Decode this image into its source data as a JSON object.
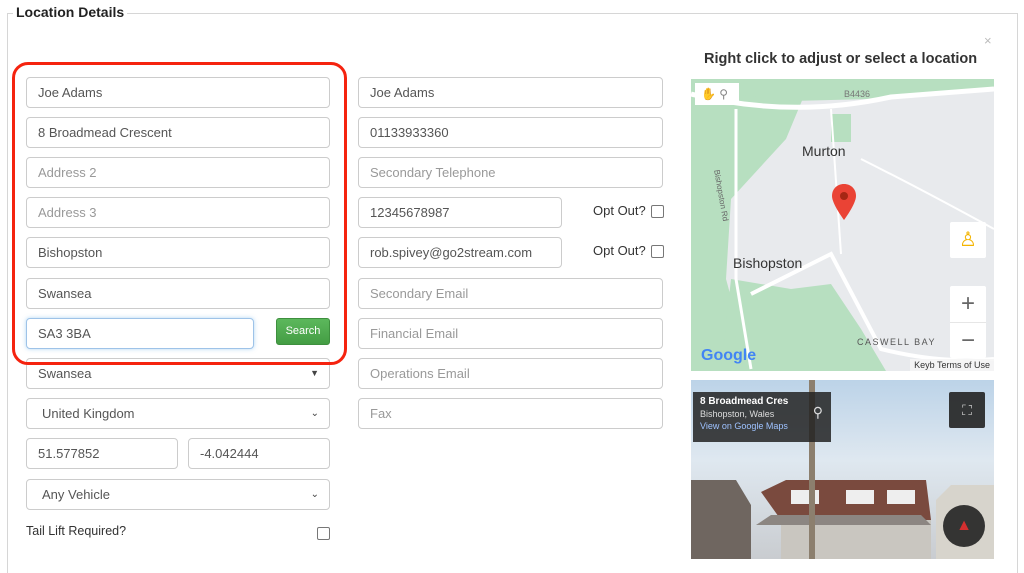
{
  "section": {
    "title": "Location Details"
  },
  "left": {
    "name": {
      "value": "Joe Adams"
    },
    "address1": {
      "value": "8 Broadmead Crescent"
    },
    "address2": {
      "placeholder": "Address 2"
    },
    "address3": {
      "placeholder": "Address 3"
    },
    "town": {
      "value": "Bishopston"
    },
    "city": {
      "value": "Swansea"
    },
    "postcode": {
      "value": "SA3 3BA"
    },
    "search_label": "Search",
    "county": {
      "selected": "Swansea"
    },
    "country": {
      "selected": "United Kingdom"
    },
    "latitude": {
      "value": "51.577852"
    },
    "longitude": {
      "value": "-4.042444"
    },
    "vehicle": {
      "selected": "Any Vehicle"
    },
    "tail_lift_label": "Tail Lift Required?",
    "tail_lift_checked": false
  },
  "middle": {
    "contact_name": {
      "value": "Joe Adams"
    },
    "telephone": {
      "value": "01133933360"
    },
    "secondary_telephone": {
      "placeholder": "Secondary Telephone"
    },
    "mobile": {
      "value": "12345678987"
    },
    "mobile_opt_out_label": "Opt Out?",
    "email": {
      "value": "rob.spivey@go2stream.com"
    },
    "email_opt_out_label": "Opt Out?",
    "secondary_email": {
      "placeholder": "Secondary Email"
    },
    "financial_email": {
      "placeholder": "Financial Email"
    },
    "operations_email": {
      "placeholder": "Operations Email"
    },
    "fax": {
      "placeholder": "Fax"
    }
  },
  "map": {
    "title": "Right click to adjust or select a location",
    "close_label": "×",
    "labels": {
      "road": "B4436",
      "murton": "Murton",
      "bishopston": "Bishopston",
      "bishopston_rd": "Bishopston Rd",
      "caswell": "CASWELL BAY"
    },
    "google_logo": "Google",
    "terms": "Keyb  Terms of Use",
    "zoom_in": "+",
    "zoom_out": "−"
  },
  "streetview": {
    "title": "8 Broadmead Cres",
    "subtitle": "Bishopston, Wales",
    "link": "View on Google Maps"
  }
}
